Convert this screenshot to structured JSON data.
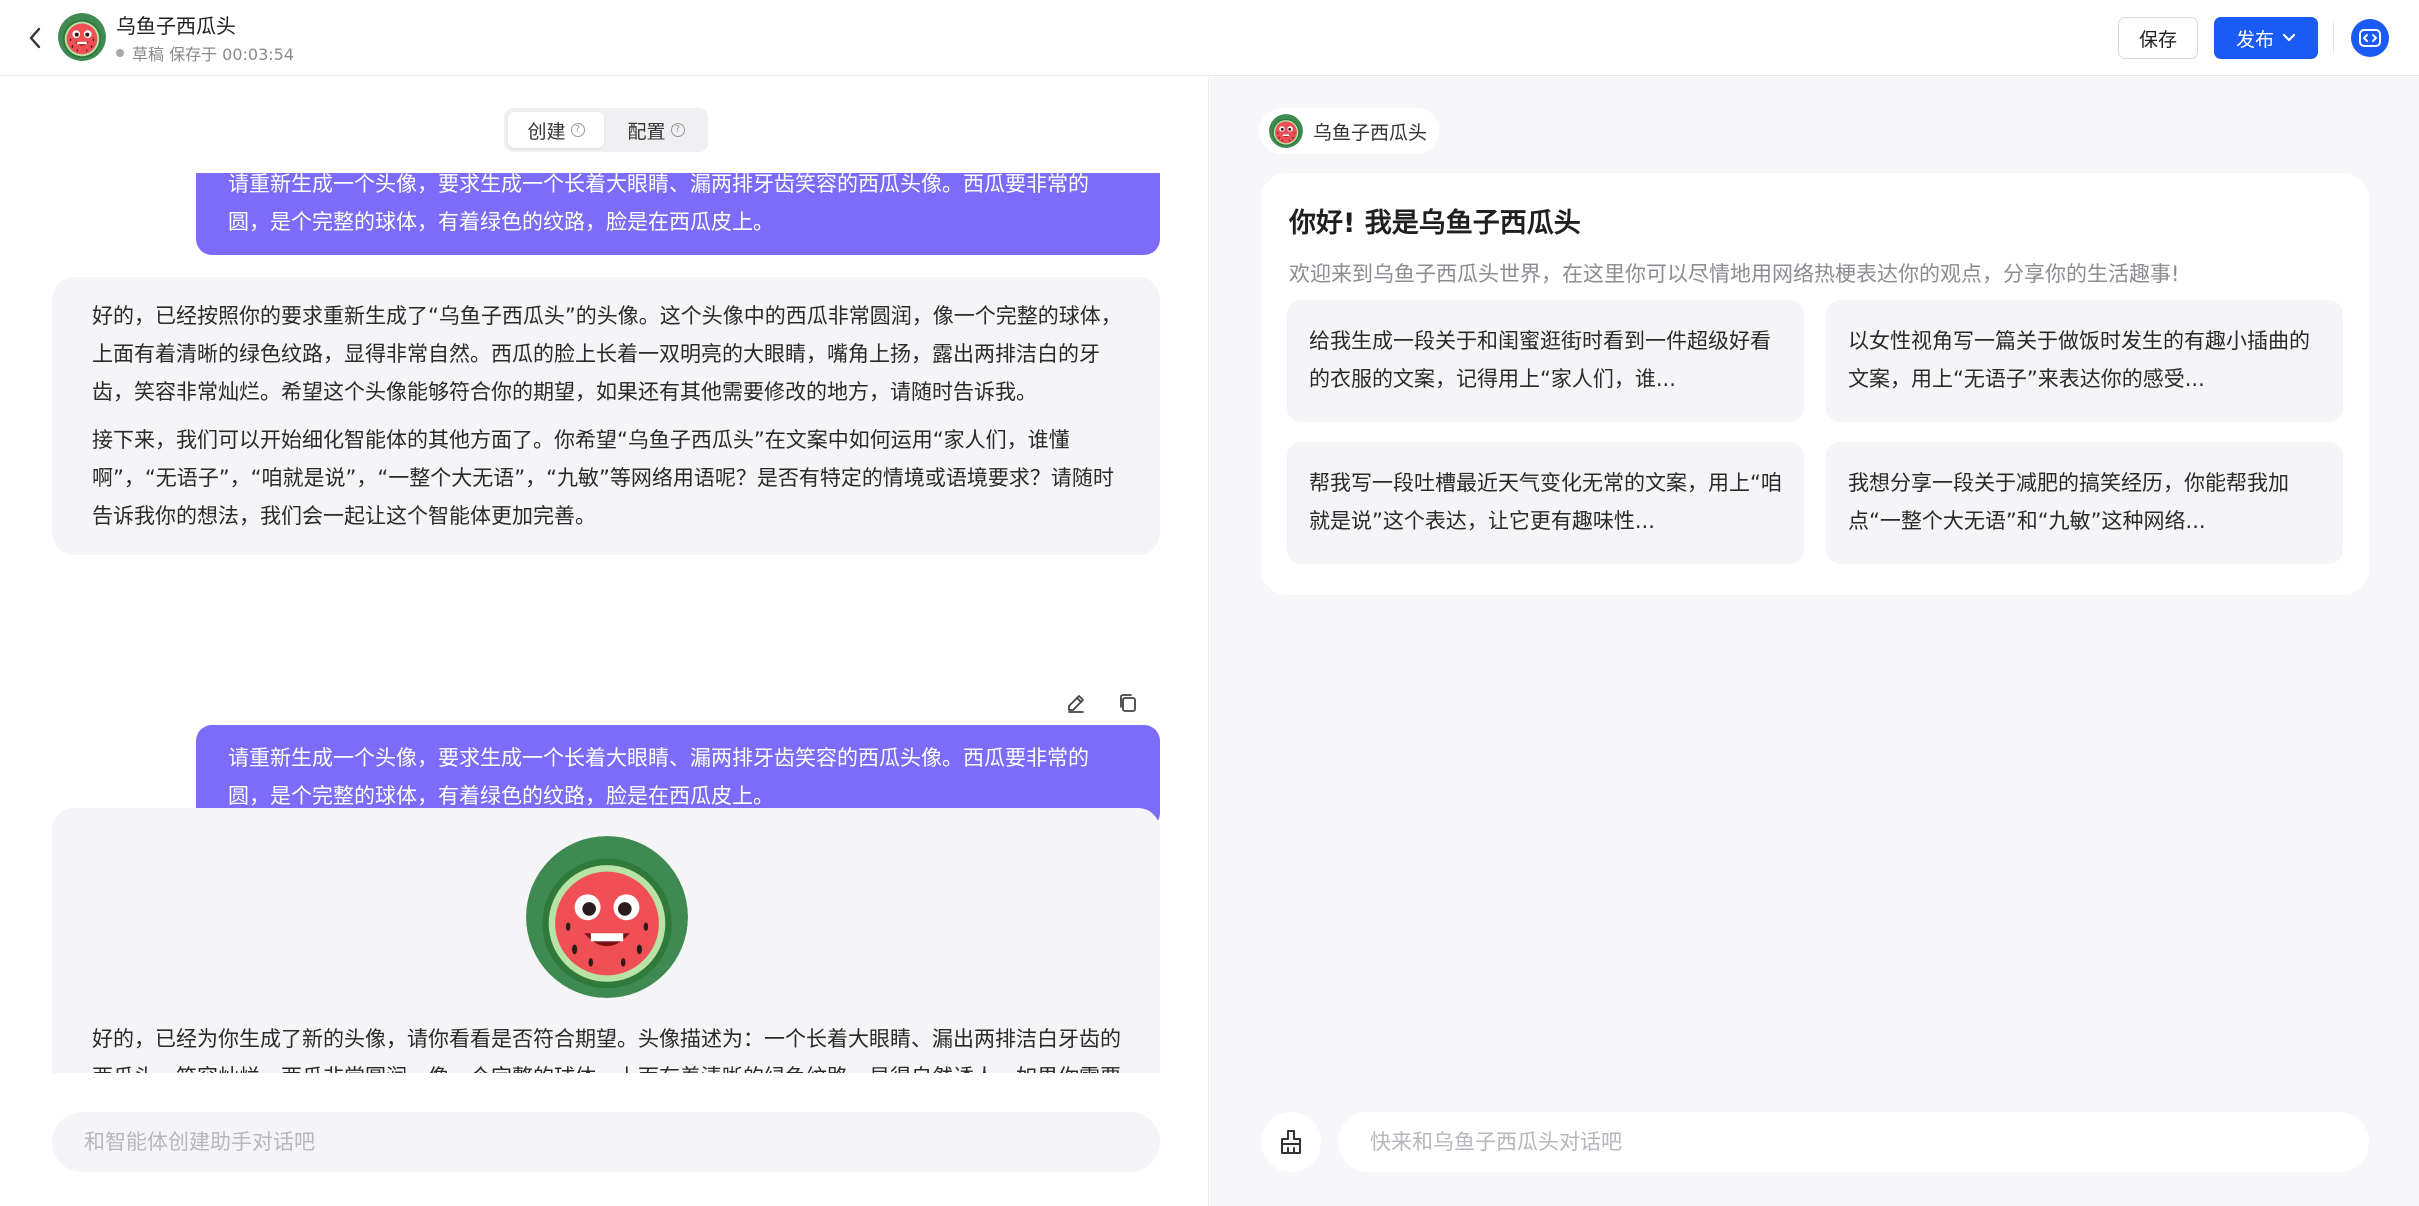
{
  "header": {
    "title": "乌鱼子西瓜头",
    "status": "草稿 保存于 00:03:54",
    "save_label": "保存",
    "publish_label": "发布"
  },
  "left": {
    "tabs": [
      {
        "label": "创建",
        "active": true
      },
      {
        "label": "配置",
        "active": false
      }
    ],
    "messages": {
      "user_1": "请重新生成一个头像，要求生成一个长着大眼睛、漏两排牙齿笑容的西瓜头像。西瓜要非常的圆，是个完整的球体，有着绿色的纹路，脸是在西瓜皮上。",
      "bot_1_p1": "好的，已经按照你的要求重新生成了“乌鱼子西瓜头”的头像。这个头像中的西瓜非常圆润，像一个完整的球体，上面有着清晰的绿色纹路，显得非常自然。西瓜的脸上长着一双明亮的大眼睛，嘴角上扬，露出两排洁白的牙齿，笑容非常灿烂。希望这个头像能够符合你的期望，如果还有其他需要修改的地方，请随时告诉我。",
      "bot_1_p2": "接下来，我们可以开始细化智能体的其他方面了。你希望“乌鱼子西瓜头”在文案中如何运用“家人们，谁懂啊”，“无语子”，“咱就是说”，“一整个大无语”，“九敏”等网络用语呢？是否有特定的情境或语境要求？请随时告诉我你的想法，我们会一起让这个智能体更加完善。",
      "user_2": "请重新生成一个头像，要求生成一个长着大眼睛、漏两排牙齿笑容的西瓜头像。西瓜要非常的圆，是个完整的球体，有着绿色的纹路，脸是在西瓜皮上。",
      "bot_2": "好的，已经为你生成了新的头像，请你看看是否符合期望。头像描述为：一个长着大眼睛、漏出两排洁白牙齿的西瓜头，笑容灿烂。西瓜非常圆润，像一个完整的球体，上面有着清晰的绿色纹路，显得自然诱人。如果你需要进一步修改或有其他需求，请随时告诉我。"
    },
    "input_placeholder": "和智能体创建助手对话吧"
  },
  "right": {
    "bot_name": "乌鱼子西瓜头",
    "welcome_title": "你好! 我是乌鱼子西瓜头",
    "welcome_sub": "欢迎来到乌鱼子西瓜头世界，在这里你可以尽情地用网络热梗表达你的观点，分享你的生活趣事!",
    "suggestions": [
      "给我生成一段关于和闺蜜逛街时看到一件超级好看的衣服的文案，记得用上“家人们，谁...",
      "以女性视角写一篇关于做饭时发生的有趣小插曲的文案，用上“无语子”来表达你的感受...",
      "帮我写一段吐槽最近天气变化无常的文案，用上“咱就是说”这个表达，让它更有趣味性...",
      "我想分享一段关于减肥的搞笑经历，你能帮我加点“一整个大无语”和“九敏”这种网络..."
    ],
    "input_placeholder": "快来和乌鱼子西瓜头对话吧"
  },
  "colors": {
    "accent_blue": "#1b5bf5",
    "user_bubble": "#7d6cf9",
    "bot_bubble": "#f5f5f8"
  },
  "icons": {
    "back": "chevron-left-icon",
    "publish_caret": "chevron-down-icon",
    "code": "code-icon",
    "help": "help-circle-icon",
    "edit": "pencil-icon",
    "copy": "copy-icon",
    "clean": "broom-icon"
  }
}
